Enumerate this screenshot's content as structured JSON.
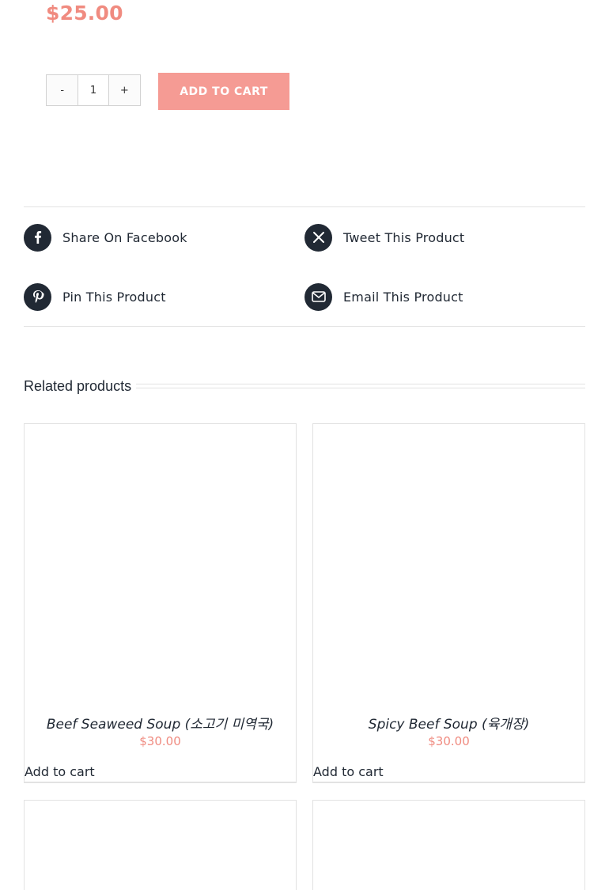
{
  "product": {
    "price": "$25.00",
    "quantity": {
      "minus_label": "-",
      "value": "1",
      "plus_label": "+"
    },
    "add_to_cart_label": "ADD TO CART"
  },
  "share": {
    "facebook_label": "Share On Facebook",
    "twitter_label": "Tweet This Product",
    "pinterest_label": "Pin This Product",
    "email_label": "Email This Product"
  },
  "related": {
    "title": "Related products",
    "items": [
      {
        "title": "Beef Seaweed Soup (소고기 미역국)",
        "price": "$30.00",
        "cart_label": "Add to cart"
      },
      {
        "title": "Spicy Beef Soup (육개장)",
        "price": "$30.00",
        "cart_label": "Add to cart"
      }
    ]
  },
  "colors": {
    "accent": "#f08b80",
    "button": "#f59b94",
    "dark": "#212934",
    "border": "#e2e2e2"
  },
  "icons": [
    "facebook-icon",
    "x-twitter-icon",
    "pinterest-icon",
    "email-icon"
  ]
}
